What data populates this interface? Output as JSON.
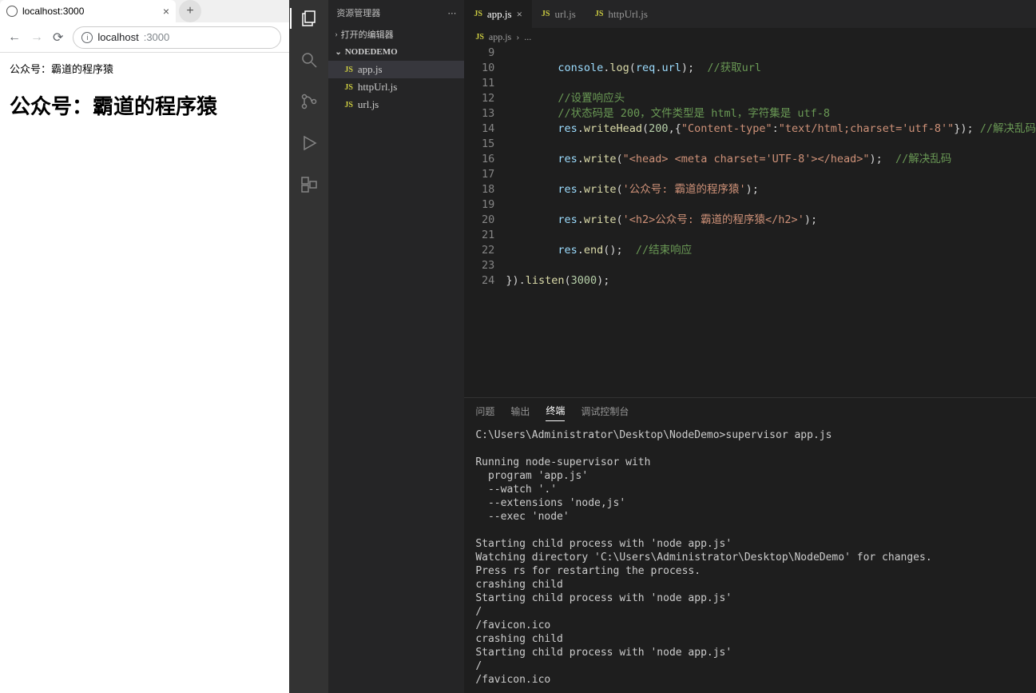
{
  "browser": {
    "tab_title": "localhost:3000",
    "url_host": "localhost",
    "url_port": ":3000",
    "page_text": "公众号：霸道的程序猿",
    "page_heading": "公众号：霸道的程序猿"
  },
  "sidebar": {
    "title": "资源管理器",
    "section_open": "打开的编辑器",
    "project": "NODEDEMO",
    "files": [
      {
        "name": "app.js",
        "active": true
      },
      {
        "name": "httpUrl.js",
        "active": false
      },
      {
        "name": "url.js",
        "active": false
      }
    ]
  },
  "editor": {
    "tabs": [
      {
        "name": "app.js",
        "active": true,
        "closable": true
      },
      {
        "name": "url.js",
        "active": false,
        "closable": false
      },
      {
        "name": "httpUrl.js",
        "active": false,
        "closable": false
      }
    ],
    "breadcrumb_file": "app.js",
    "breadcrumb_sep": "›",
    "breadcrumb_more": "...",
    "lines": [
      {
        "n": 9,
        "html": ""
      },
      {
        "n": 10,
        "html": "        <span class='c-var'>console</span>.<span class='c-fn'>log</span>(<span class='c-var'>req</span>.<span class='c-prop'>url</span>);  <span class='c-cmt'>//获取url</span>"
      },
      {
        "n": 11,
        "html": ""
      },
      {
        "n": 12,
        "html": "        <span class='c-cmt'>//设置响应头</span>"
      },
      {
        "n": 13,
        "html": "        <span class='c-cmt'>//状态码是 200，文件类型是 html，字符集是 utf-8</span>"
      },
      {
        "n": 14,
        "html": "        <span class='c-var'>res</span>.<span class='c-fn'>writeHead</span>(<span class='c-num'>200</span>,{<span class='c-str'>\"Content-type\"</span>:<span class='c-str'>\"text/html;charset='utf-8'\"</span>}); <span class='c-cmt'>//解决乱码</span>"
      },
      {
        "n": 15,
        "html": ""
      },
      {
        "n": 16,
        "html": "        <span class='c-var'>res</span>.<span class='c-fn'>write</span>(<span class='c-str'>\"&lt;head&gt; &lt;meta charset='UTF-8'&gt;&lt;/head&gt;\"</span>);  <span class='c-cmt'>//解决乱码</span>"
      },
      {
        "n": 17,
        "html": ""
      },
      {
        "n": 18,
        "html": "        <span class='c-var'>res</span>.<span class='c-fn'>write</span>(<span class='c-str'>'公众号: 霸道的程序猿'</span>);"
      },
      {
        "n": 19,
        "html": ""
      },
      {
        "n": 20,
        "html": "        <span class='c-var'>res</span>.<span class='c-fn'>write</span>(<span class='c-str'>'&lt;h2&gt;公众号: 霸道的程序猿&lt;/h2&gt;'</span>);"
      },
      {
        "n": 21,
        "html": ""
      },
      {
        "n": 22,
        "html": "        <span class='c-var'>res</span>.<span class='c-fn'>end</span>();  <span class='c-cmt'>//结束响应</span>"
      },
      {
        "n": 23,
        "html": ""
      },
      {
        "n": 24,
        "html": "}).<span class='c-fn'>listen</span>(<span class='c-num'>3000</span>);"
      }
    ]
  },
  "panel": {
    "tabs": {
      "problems": "问题",
      "output": "输出",
      "terminal": "终端",
      "debug": "调试控制台"
    },
    "terminal": "C:\\Users\\Administrator\\Desktop\\NodeDemo>supervisor app.js\n\nRunning node-supervisor with\n  program 'app.js'\n  --watch '.'\n  --extensions 'node,js'\n  --exec 'node'\n\nStarting child process with 'node app.js'\nWatching directory 'C:\\Users\\Administrator\\Desktop\\NodeDemo' for changes.\nPress rs for restarting the process.\ncrashing child\nStarting child process with 'node app.js'\n/\n/favicon.ico\ncrashing child\nStarting child process with 'node app.js'\n/\n/favicon.ico"
  }
}
